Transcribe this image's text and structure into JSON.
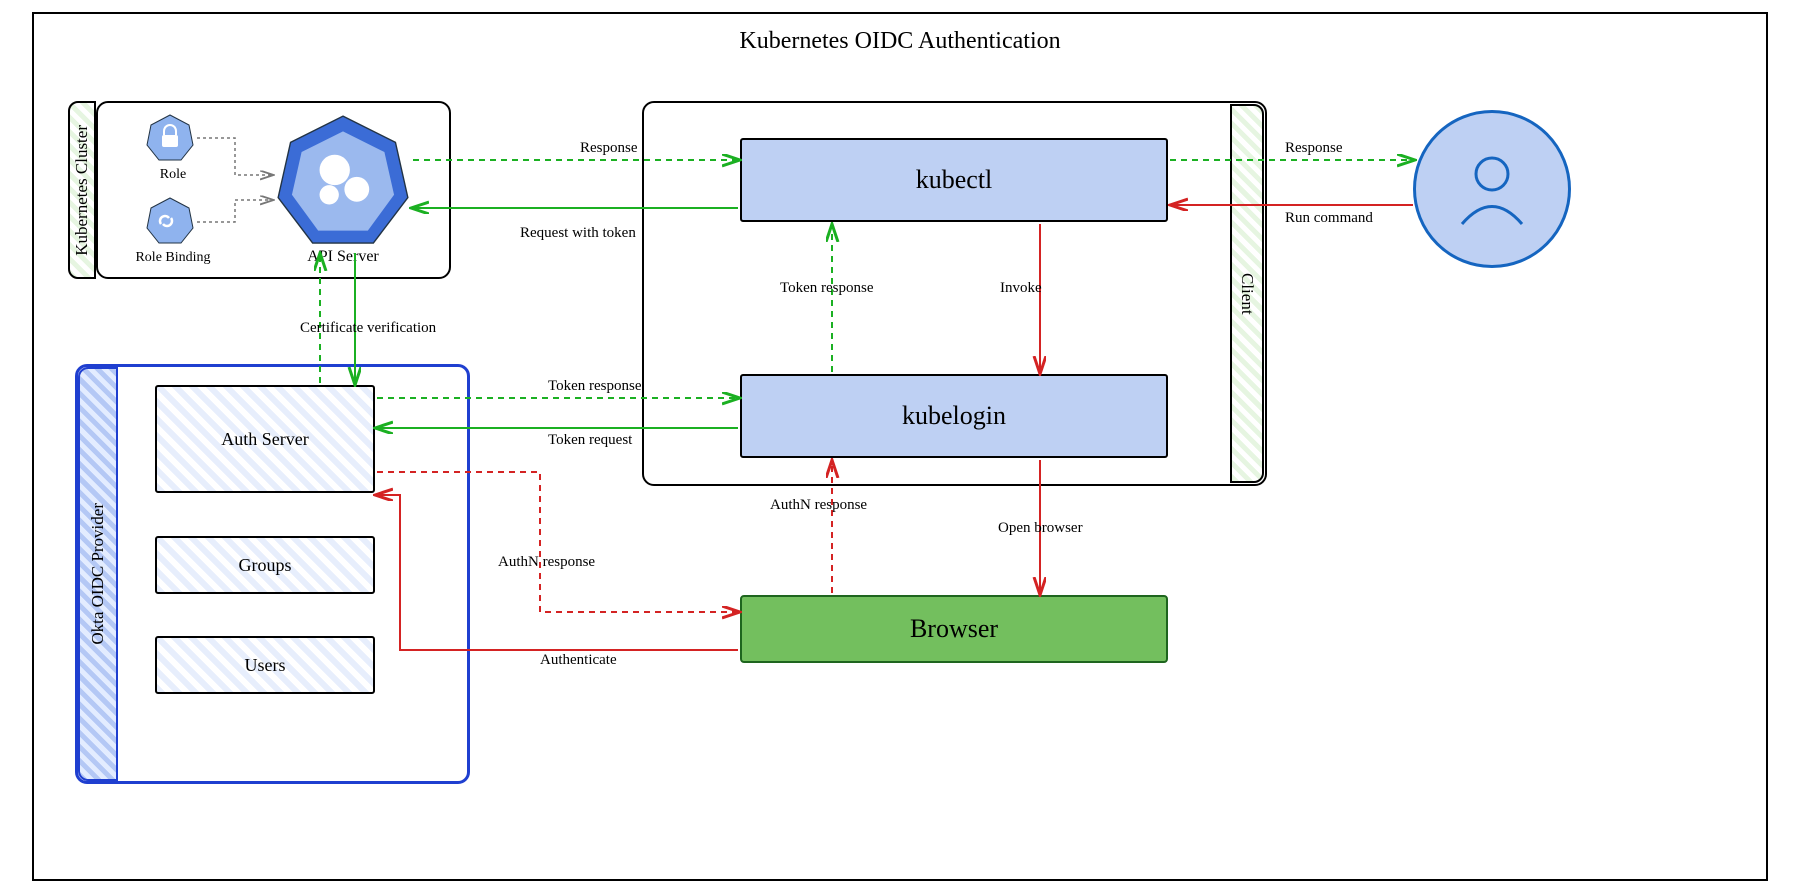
{
  "title": "Kubernetes OIDC Authentication",
  "k8s_cluster": {
    "label": "Kubernetes Cluster",
    "api_server": "API Server",
    "role": "Role",
    "role_binding": "Role Binding"
  },
  "okta": {
    "label": "Okta OIDC Provider",
    "auth_server": "Auth Server",
    "groups": "Groups",
    "users": "Users"
  },
  "client": {
    "label": "Client",
    "kubectl": "kubectl",
    "kubelogin": "kubelogin"
  },
  "browser": "Browser",
  "edges": {
    "user_to_kubectl": "Run command",
    "kubectl_to_user_response": "Response",
    "kubectl_to_kubelogin": "Invoke",
    "kubelogin_to_kubectl": "Token response",
    "kubelogin_to_browser": "Open browser",
    "browser_to_kubelogin": "AuthN response",
    "browser_to_auth": "Authenticate",
    "auth_to_browser": "AuthN response",
    "kubelogin_to_auth_token_req": "Token request",
    "auth_to_kubelogin_token_resp": "Token response",
    "api_to_auth_cert": "Certificate verification",
    "kubectl_to_api_req": "Request with token",
    "api_to_kubectl_resp": "Response"
  },
  "colors": {
    "green": "#1bb022",
    "red": "#d42323",
    "blue": "#1f3fd0",
    "node_fill": "#bed0f3",
    "browser_fill": "#73bf5e"
  }
}
